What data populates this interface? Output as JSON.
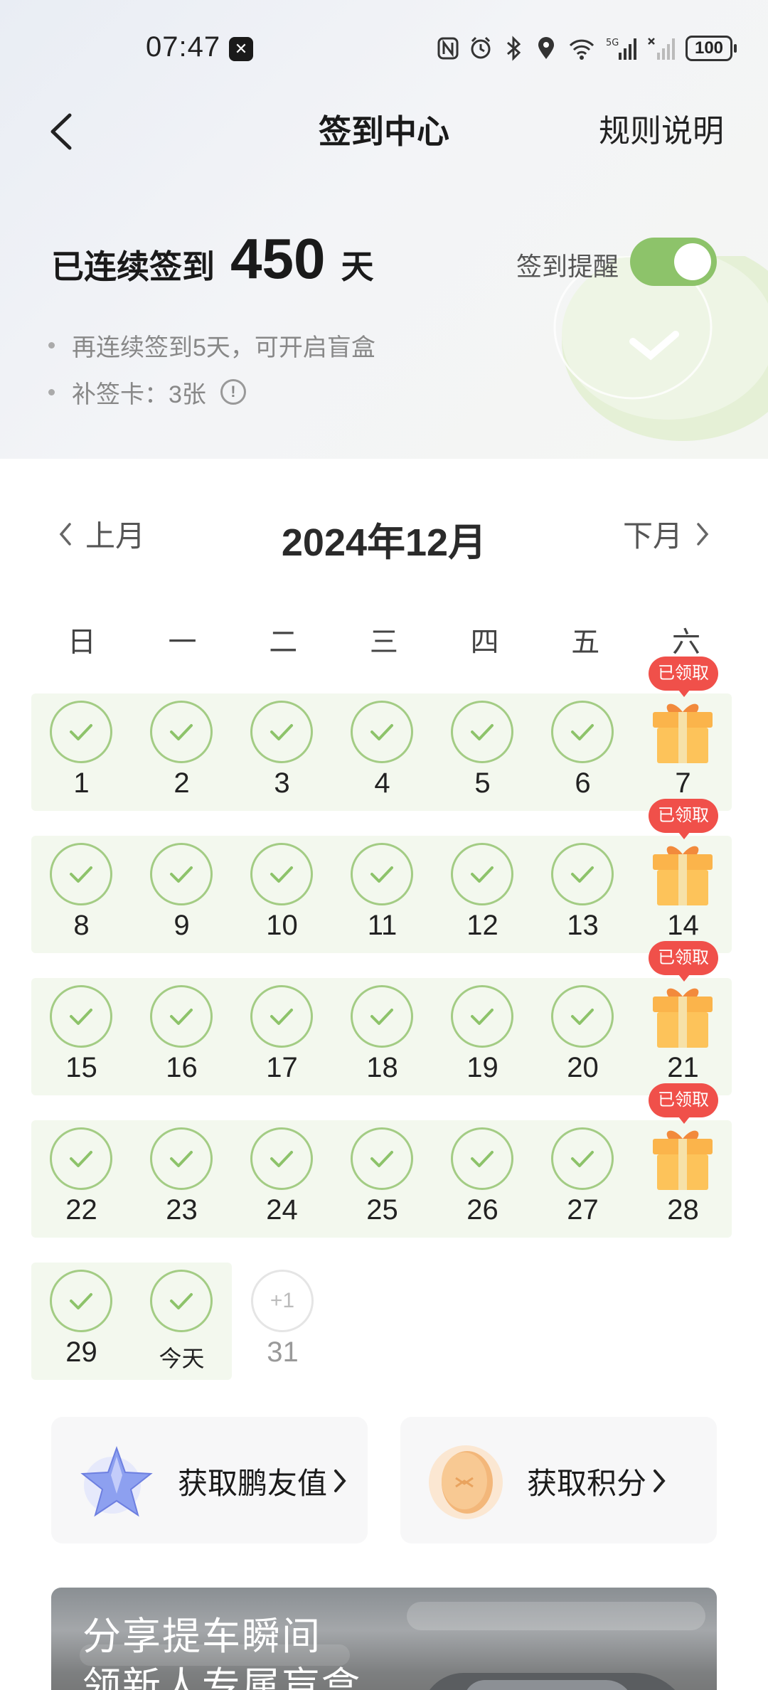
{
  "status_bar": {
    "time": "07:47",
    "battery": "100"
  },
  "header": {
    "title": "签到中心",
    "rules_label": "规则说明"
  },
  "streak": {
    "prefix": "已连续签到",
    "days": "450",
    "suffix": "天"
  },
  "reminder": {
    "label": "签到提醒",
    "enabled": true
  },
  "tips": {
    "blind_box": "再连续签到5天，可开启盲盒",
    "makeup_cards": "补签卡：3张",
    "info_glyph": "!"
  },
  "calendar": {
    "month_title": "2024年12月",
    "prev_label": "上月",
    "next_label": "下月",
    "weekdays": [
      "日",
      "一",
      "二",
      "三",
      "四",
      "五",
      "六"
    ],
    "claimed_label": "已领取",
    "weeks": [
      [
        "1",
        "2",
        "3",
        "4",
        "5",
        "6",
        "7"
      ],
      [
        "8",
        "9",
        "10",
        "11",
        "12",
        "13",
        "14"
      ],
      [
        "15",
        "16",
        "17",
        "18",
        "19",
        "20",
        "21"
      ],
      [
        "22",
        "23",
        "24",
        "25",
        "26",
        "27",
        "28"
      ]
    ],
    "last_week": {
      "day29": "29",
      "today": "今天",
      "day31": "31",
      "day31_bonus": "+1"
    }
  },
  "cards": {
    "points_friend": "获取鹏友值",
    "points": "获取积分"
  },
  "banner": {
    "line1": "分享提车瞬间",
    "line2": "领新人专属盲盒"
  },
  "colors": {
    "accent_green": "#8dc36a",
    "check_green": "#a3cc84",
    "badge_red": "#f0504a",
    "row_bg": "#f3f8ee"
  }
}
